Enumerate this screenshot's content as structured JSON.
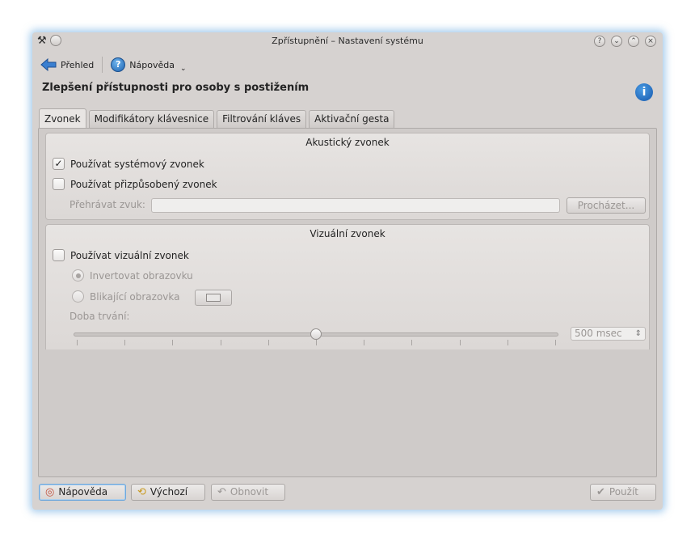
{
  "window": {
    "title": "Zpřístupnění – Nastavení systému"
  },
  "toolbar": {
    "overview_label": "Přehled",
    "help_label": "Nápověda"
  },
  "heading": "Zlepšení přístupnosti pro osoby s postižením",
  "tabs": [
    {
      "label": "Zvonek",
      "active": true
    },
    {
      "label": "Modifikátory klávesnice",
      "active": false
    },
    {
      "label": "Filtrování kláves",
      "active": false
    },
    {
      "label": "Aktivační gesta",
      "active": false
    }
  ],
  "acoustic": {
    "title": "Akustický zvonek",
    "use_system_bell": {
      "label": "Používat systémový zvonek",
      "checked": true
    },
    "use_custom_bell": {
      "label": "Používat přizpůsobený zvonek",
      "checked": false
    },
    "play_sound_label": "Přehrávat zvuk:",
    "play_sound_value": "",
    "browse_label": "Procházet..."
  },
  "visual": {
    "title": "Vizuální zvonek",
    "use_visual_bell": {
      "label": "Používat vizuální zvonek",
      "checked": false
    },
    "invert_screen": {
      "label": "Invertovat obrazovku",
      "selected": true
    },
    "flash_screen": {
      "label": "Blikající obrazovka",
      "selected": false
    },
    "duration_label": "Doba trvání:",
    "duration_value": "500 msec",
    "duration_fraction": 0.5
  },
  "buttons": {
    "help": "Nápověda",
    "defaults": "Výchozí",
    "reset": "Obnovit",
    "apply": "Použít"
  },
  "colors": {
    "accent": "#1f64b2",
    "window_bg": "#d6d2d0"
  }
}
